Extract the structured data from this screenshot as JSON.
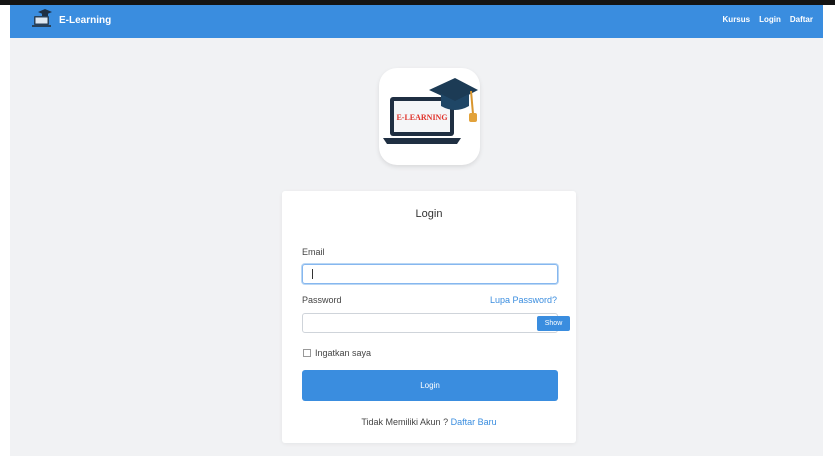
{
  "navbar": {
    "brand": "E-Learning",
    "links": [
      "Kursus",
      "Login",
      "Daftar"
    ],
    "color": "#3a8ddf"
  },
  "logo": {
    "text": "E-LEARNING",
    "text_color": "#e0322a",
    "icon": "graduation-cap-laptop-icon"
  },
  "login_card": {
    "title": "Login",
    "email_label": "Email",
    "email_value": "",
    "password_label": "Password",
    "forgot_link": "Lupa Password?",
    "password_value": "",
    "show_button": "Show",
    "remember_label": "Ingatkan saya",
    "remember_checked": false,
    "submit_button": "Login",
    "no_account_text": "Tidak Memiliki Akun ?",
    "register_link": "Daftar Baru"
  }
}
